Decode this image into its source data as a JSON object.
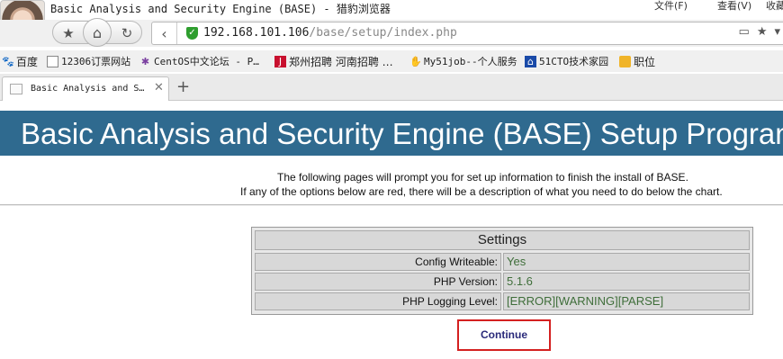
{
  "window": {
    "title": "Basic Analysis and Security Engine (BASE) - 猎豹浏览器",
    "menu": [
      "文件(F)",
      "查看(V)",
      "收藏"
    ]
  },
  "navigation": {
    "url_host": "192.168.101.106",
    "url_path": "/base/setup/index.php"
  },
  "bookmarks": [
    {
      "icon": "baidu-paw-icon",
      "label": "百度"
    },
    {
      "icon": "page-icon",
      "label": "12306订票网站"
    },
    {
      "icon": "centos-icon",
      "label": "CentOS中文论坛 - P…"
    },
    {
      "icon": "job-site-icon",
      "label": "郑州招聘 河南招聘 …"
    },
    {
      "icon": "hand-icon",
      "label": "My51job--个人服务"
    },
    {
      "icon": "51cto-icon",
      "label": "51CTO技术家园"
    },
    {
      "icon": "folder-icon",
      "label": "职位"
    }
  ],
  "tabs": [
    {
      "label": "Basic Analysis and S…"
    }
  ],
  "page": {
    "banner_title": "Basic Analysis and Security Engine (BASE) Setup Program",
    "intro_line1": "The following pages will prompt you for set up information to finish the install of BASE.",
    "intro_line2": "If any of the options below are red, there will be a description of what you need to do below the chart.",
    "settings": {
      "heading": "Settings",
      "rows": [
        {
          "key": "Config Writeable:",
          "value": "Yes"
        },
        {
          "key": "PHP Version:",
          "value": "5.1.6"
        },
        {
          "key": "PHP Logging Level:",
          "value": "[ERROR][WARNING][PARSE]"
        }
      ]
    },
    "continue_label": "Continue"
  },
  "colors": {
    "banner": "#2f6a8f",
    "setting_value": "#3f6e3a",
    "continue_border": "#d42020"
  }
}
